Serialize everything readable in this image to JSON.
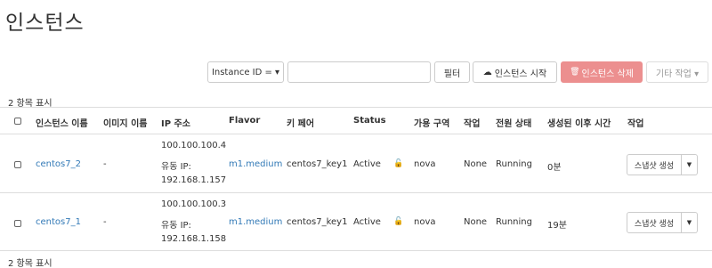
{
  "page": {
    "title": "인스턴스"
  },
  "toolbar": {
    "filter_select": "Instance ID = ▾",
    "filter_input_value": "",
    "filter_button": "필터",
    "start_button": "인스턴스 시작",
    "delete_button": "인스턴스 삭제",
    "more_button": "기타 작업 ▾"
  },
  "summary": {
    "count_top": "2 항목 표시",
    "count_bottom": "2 항목 표시"
  },
  "table": {
    "headers": [
      "인스턴스 이름",
      "이미지 이름",
      "IP 주소",
      "Flavor",
      "키 페어",
      "Status",
      "가용 구역",
      "작업",
      "전원 상태",
      "생성된 이후 시간",
      "작업"
    ],
    "rows": [
      {
        "name": "centos7_2",
        "image": "-",
        "ip": [
          "100.100.100.4",
          "유동 IP:",
          "192.168.1.157"
        ],
        "flavor": "m1.medium",
        "keypair": "centos7_key1",
        "status": "Active",
        "zone": "nova",
        "task": "None",
        "power": "Running",
        "age": "0분",
        "action": "스냅샷 생성"
      },
      {
        "name": "centos7_1",
        "image": "-",
        "ip": [
          "100.100.100.3",
          "유동 IP:",
          "192.168.1.158"
        ],
        "flavor": "m1.medium",
        "keypair": "centos7_key1",
        "status": "Active",
        "zone": "nova",
        "task": "None",
        "power": "Running",
        "age": "19분",
        "action": "스냅샷 생성"
      }
    ]
  },
  "colors": {
    "link": "#337ab7",
    "danger": "#ec8f8f",
    "border": "#dddddd"
  }
}
